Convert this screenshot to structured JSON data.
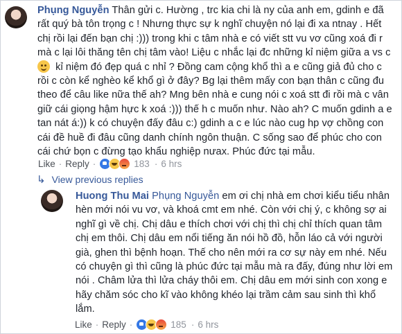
{
  "main_comment": {
    "author": "Phụng Nguyễn",
    "lines": [
      "Thân gửi c. Hường , trc kia chi là ny của anh em, gdinh e đã",
      "rất quý bà tôn trọng c ! Nhưng thực sự k nghĩ chuyện nó lại đi xa ntnay . Hết",
      "chị rồi lại đến bạn chị :))) trong khi c tâm nhà e có viết stt vu vơ cũng xoá đi r",
      "mà c lại lôi thăng tên chị tâm vào! Liệu c nhắc lại đc những kỉ niệm giữa a vs c",
      "kỉ niệm đó đẹp quá c nhỉ ? Đồng cam cộng khổ thì a e cũng giả đủ cho c",
      "rồi c còn kể nghèo kể khổ gì ở đây? Bg lại thêm mấy con bạn thân c cũng đu",
      "theo để câu like nữa thế ah? Mng bên nhà e cung nói c xoá stt đi rồi mà c vân",
      "giữ cái giọng hậm hực k xoá :))) thế h c muốn như. Nào ah? C muốn gdinh a e",
      "tan nát á:)) k có chuyện đấy đâu c:) gdinh a c e lúc nào cug hp vợ chồng con",
      "cái đề huề đi đâu cũng danh chính ngôn thuận. C sống sao để phúc cho con",
      "cái chứ bọn c đừng tạo khẩu nghiệp nưax. Phúc đức tại mẫu."
    ],
    "actions": {
      "like": "Like",
      "reply": "Reply",
      "reaction_count": "183",
      "time": "6 hrs"
    },
    "reactions": [
      "like",
      "haha",
      "angry"
    ]
  },
  "view_replies": {
    "arrow": "↳",
    "label": "View previous replies"
  },
  "reply_comment": {
    "author": "Huong Thu Mai",
    "mention": "Phụng Nguyễn",
    "lines": [
      " em ơi chị nhà em chơi kiểu tiểu nhân",
      "hèn mới nói vu vơ, và khoá cmt em nhé. Còn với chị ý, c không sợ ai",
      "nghĩ gì về chị. Chị dâu e thích chơi với chị thì chị chỉ thích quan tâm",
      "chị em thôi. Chị dâu em nổi tiếng ăn nói hồ đồ, hỗn láo cả với người",
      "già, ghen thì bệnh hoạn. Thế cho nên mới ra cơ sự này em nhé. Nếu",
      "có chuyện gì thì cũng là phúc đức tại mẫu mà ra đấy, đúng như lời em",
      "nói . Châm lửa thì lửa cháy thôi em. Chị dâu em mới sinh con xong e",
      "hãy chăm sóc cho kĩ vào không khéo lại trầm cảm sau sinh thì khổ",
      "lắm."
    ],
    "actions": {
      "like": "Like",
      "reply": "Reply",
      "reaction_count": "185",
      "time": "6 hrs"
    },
    "reactions": [
      "like",
      "haha",
      "angry"
    ]
  },
  "colors": {
    "link": "#365899",
    "meta": "#90949c",
    "text": "#1d2129"
  },
  "icons": {
    "inline_emoji": "smiley-emoji-icon"
  }
}
